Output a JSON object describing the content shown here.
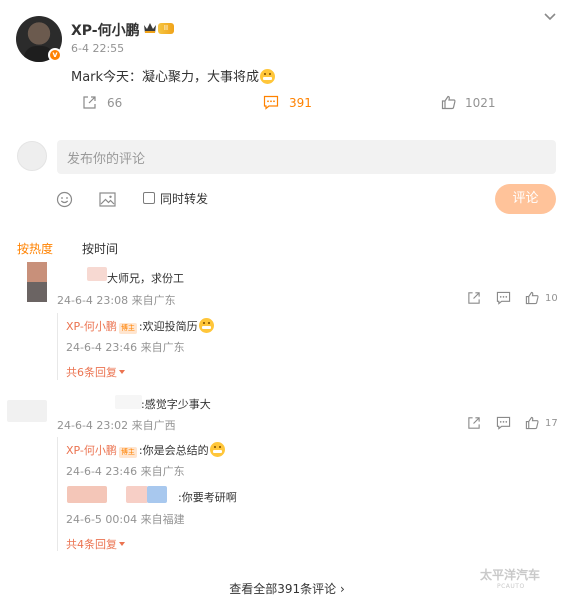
{
  "post": {
    "author": "XP-何小鹏",
    "time": "6-4 22:55",
    "text": "Mark今天：凝心聚力，大事将成",
    "level_badge": "II",
    "verified_badge": "v",
    "repost_count": "66",
    "comment_count": "391",
    "like_count": "1021"
  },
  "compose": {
    "placeholder": "发布你的评论",
    "repost_label": "同时转发",
    "submit_label": "评论"
  },
  "tabs": {
    "hot": "按热度",
    "time": "按时间"
  },
  "host_badge": "博主",
  "comments": [
    {
      "text": "大师兄，求份工",
      "meta": "24-6-4 23:08 来自广东",
      "likes": "10",
      "replies": [
        {
          "author": "XP-何小鹏",
          "text": ":欢迎投简历",
          "meta": "24-6-4 23:46 来自广东"
        }
      ],
      "more_replies": "共6条回复"
    },
    {
      "text": ":感觉字少事大",
      "meta": "24-6-4 23:02 来自广西",
      "likes": "17",
      "replies": [
        {
          "author": "XP-何小鹏",
          "text": ":你是会总结的",
          "meta": "24-6-4 23:46 来自广东"
        },
        {
          "author": "",
          "text": ":你要考研啊",
          "meta": "24-6-5 00:04 来自福建"
        }
      ],
      "more_replies": "共4条回复"
    }
  ],
  "view_all": "查看全部391条评论",
  "watermark": {
    "main": "太平洋汽车",
    "sub": "PCAUTO"
  },
  "colors": {
    "accent": "#ff8200",
    "reply_name": "#eb7350",
    "button_disabled": "#ffc39a"
  }
}
